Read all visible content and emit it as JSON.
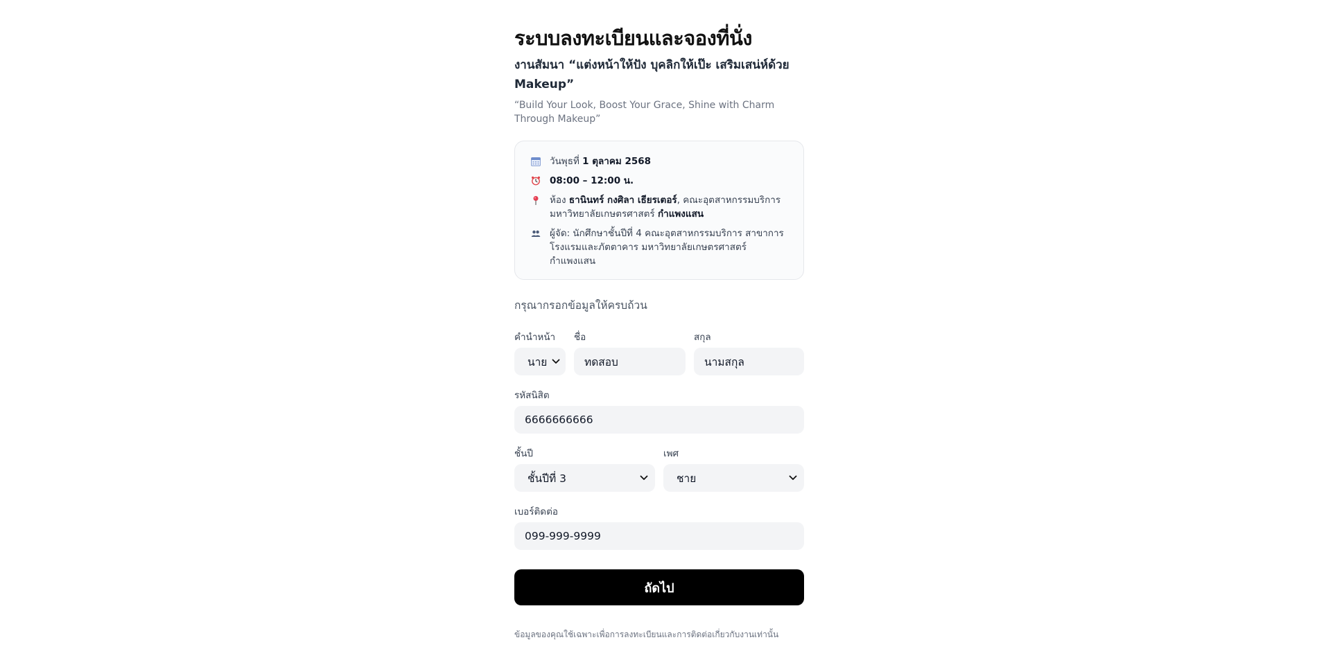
{
  "header": {
    "title": "ระบบลงทะเบียนและจองที่นั่ง",
    "subtitle": "งานสัมนา “แต่งหน้าให้ปัง บุคลิกให้เป๊ะ เสริมเสน่ห์ด้วย Makeup”",
    "subtitle_en": "“Build Your Look, Boost Your Grace, Shine with Charm Through Makeup”"
  },
  "event_info": {
    "date_prefix": "วันพุธที่",
    "date": "1 ตุลาคม 2568",
    "time": "08:00 – 12:00 น.",
    "room_prefix": "ห้อง",
    "room_name": "ธานินทร์ กงศิลา เธียรเตอร์",
    "room_mid": ", คณะอุตสาหกรรมบริการ มหาวิทยาลัยเกษตรศาสตร์",
    "campus": "กำแพงแสน",
    "organizer": "ผู้จัด: นักศึกษาชั้นปีที่ 4 คณะอุตสาหกรรมบริการ สาขาการโรงแรมและภัตตาคาร มหาวิทยาลัยเกษตรศาสตร์ กำแพงแสน"
  },
  "form": {
    "hint": "กรุณากรอกข้อมูลให้ครบถ้วน",
    "prefix_label": "คำนำหน้า",
    "prefix_value": "นาย",
    "first_name_label": "ชื่อ",
    "first_name_value": "ทดสอบ",
    "last_name_label": "สกุล",
    "last_name_value": "นามสกุล",
    "student_id_label": "รหัสนิสิต",
    "student_id_value": "6666666666",
    "year_label": "ชั้นปี",
    "year_value": "ชั้นปีที่ 3",
    "gender_label": "เพศ",
    "gender_value": "ชาย",
    "phone_label": "เบอร์ติดต่อ",
    "phone_value": "099-999-9999",
    "submit_label": "ถัดไป",
    "footnote": "ข้อมูลของคุณใช้เฉพาะเพื่อการลงทะเบียนและการติดต่อเกี่ยวกับงานเท่านั้น"
  },
  "icons": {
    "date": "calendar-icon",
    "time": "alarm-clock-icon",
    "location": "pin-icon",
    "organizer": "people-icon"
  },
  "colors": {
    "button_bg": "#000000",
    "field_bg": "#f3f4f6",
    "card_border": "#e5e7eb"
  }
}
